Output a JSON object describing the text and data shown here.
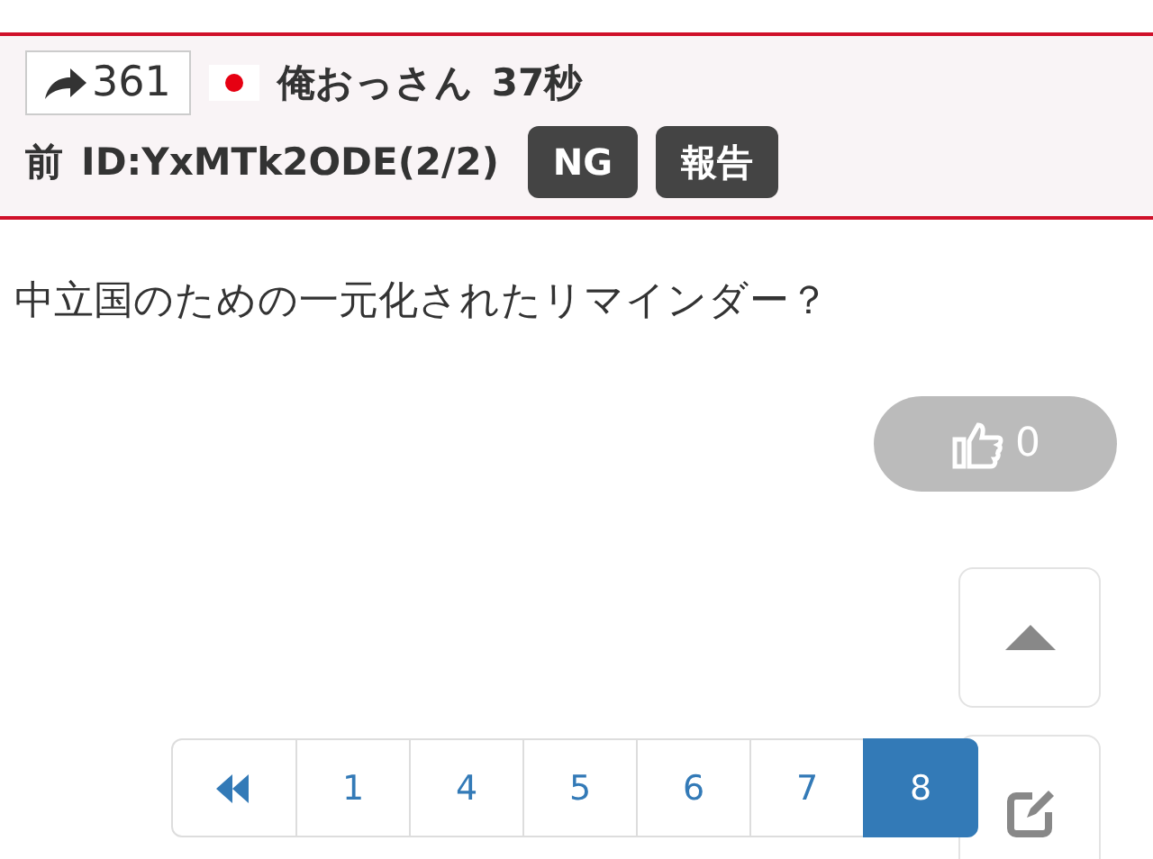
{
  "post_header": {
    "share_count": "361",
    "name": "俺おっさん",
    "time": "37秒",
    "prev_link": "前",
    "id": "ID:YxMTk2ODE(2/2)",
    "buttons": [
      "NG",
      "報告"
    ]
  },
  "post_body": "中立国のための一元化されたリマインダー？",
  "like_count": "0",
  "pagination": [
    {
      "label": "1",
      "selected": false
    },
    {
      "label": "4",
      "selected": false
    },
    {
      "label": "5",
      "selected": false
    },
    {
      "label": "6",
      "selected": false
    },
    {
      "label": "7",
      "selected": false
    },
    {
      "label": "8",
      "selected": true
    }
  ]
}
